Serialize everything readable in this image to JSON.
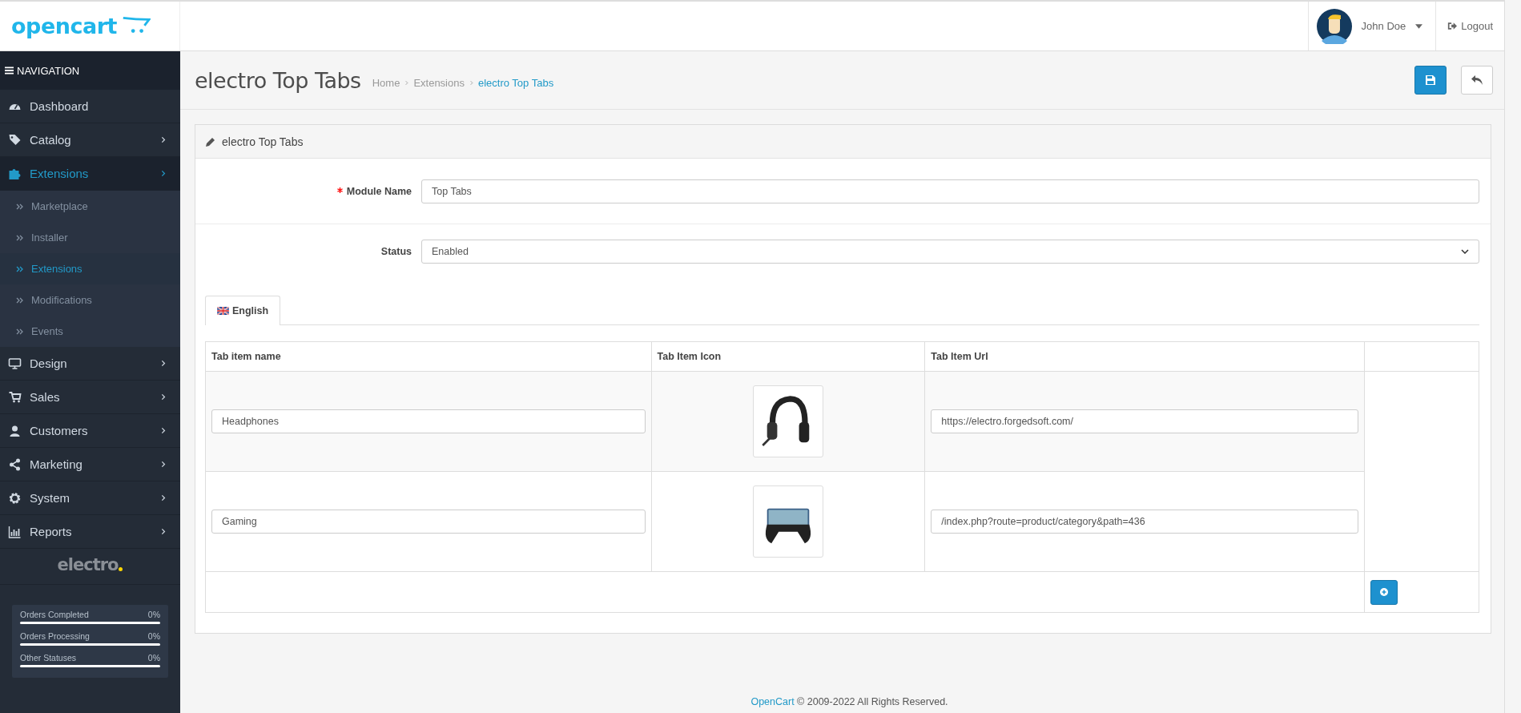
{
  "header": {
    "logo": "opencart",
    "user_name": "John Doe",
    "logout": "Logout"
  },
  "sidebar": {
    "title": "NAVIGATION",
    "items": [
      {
        "label": "Dashboard",
        "kind": "link",
        "selected": false
      },
      {
        "label": "Catalog",
        "kind": "menu",
        "selected": false
      },
      {
        "label": "Extensions",
        "kind": "menu",
        "selected": true,
        "expanded": true,
        "children": [
          {
            "label": "Marketplace",
            "selected": false
          },
          {
            "label": "Installer",
            "selected": false
          },
          {
            "label": "Extensions",
            "selected": true
          },
          {
            "label": "Modifications",
            "selected": false
          },
          {
            "label": "Events",
            "selected": false
          }
        ]
      },
      {
        "label": "Design",
        "kind": "menu",
        "selected": false
      },
      {
        "label": "Sales",
        "kind": "menu",
        "selected": false
      },
      {
        "label": "Customers",
        "kind": "menu",
        "selected": false
      },
      {
        "label": "Marketing",
        "kind": "menu",
        "selected": false
      },
      {
        "label": "System",
        "kind": "menu",
        "selected": false
      },
      {
        "label": "Reports",
        "kind": "menu",
        "selected": false
      }
    ],
    "brand": "electro",
    "stats": [
      {
        "label": "Orders Completed",
        "value": "0%",
        "level": 0
      },
      {
        "label": "Orders Processing",
        "value": "0%",
        "level": 0
      },
      {
        "label": "Other Statuses",
        "value": "0%",
        "level": 0
      }
    ]
  },
  "page": {
    "title": "electro Top Tabs",
    "breadcrumbs": [
      {
        "label": "Home",
        "active": false
      },
      {
        "label": "Extensions",
        "active": false
      },
      {
        "label": "electro Top Tabs",
        "active": true
      }
    ],
    "panel_title": "electro Top Tabs",
    "fields": [
      {
        "label": "Module Name",
        "required": true,
        "kind": "text",
        "value": "Top Tabs"
      },
      {
        "label": "Status",
        "required": false,
        "kind": "select",
        "value": "Enabled"
      }
    ],
    "tabs": [
      {
        "label": "English",
        "selected": true
      }
    ],
    "table": {
      "columns": [
        "Tab item name",
        "Tab Item Icon",
        "Tab Item Url"
      ],
      "rows": [
        {
          "name": "Headphones",
          "url": "https://electro.forgedsoft.com/"
        },
        {
          "name": "Gaming",
          "url": "/index.php?route=product/category&path=436"
        }
      ]
    }
  },
  "footer": {
    "link": "OpenCart",
    "text": "© 2009-2022 All Rights Reserved."
  }
}
